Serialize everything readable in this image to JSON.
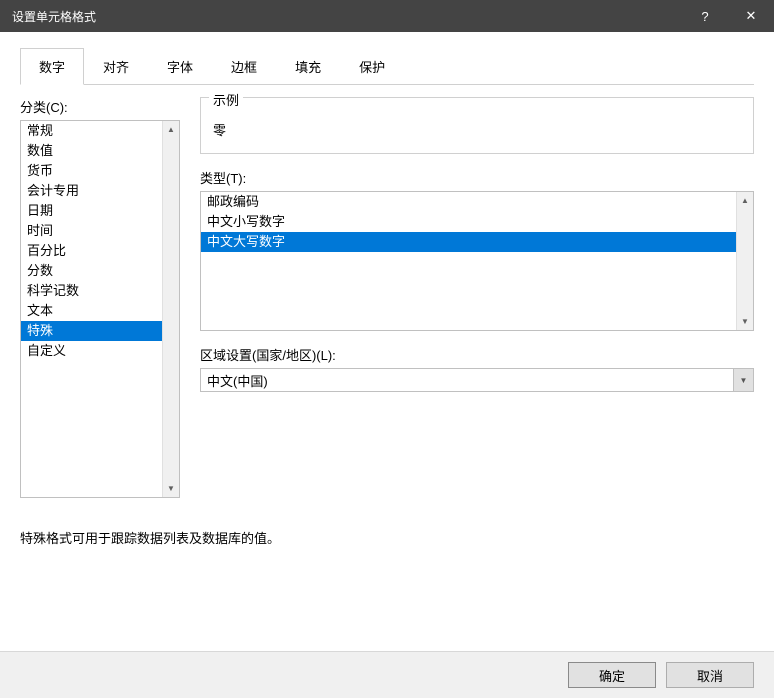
{
  "titlebar": {
    "title": "设置单元格格式",
    "help": "?",
    "close": "✕"
  },
  "tabs": [
    {
      "label": "数字",
      "active": true
    },
    {
      "label": "对齐",
      "active": false
    },
    {
      "label": "字体",
      "active": false
    },
    {
      "label": "边框",
      "active": false
    },
    {
      "label": "填充",
      "active": false
    },
    {
      "label": "保护",
      "active": false
    }
  ],
  "category": {
    "label": "分类(C):",
    "items": [
      "常规",
      "数值",
      "货币",
      "会计专用",
      "日期",
      "时间",
      "百分比",
      "分数",
      "科学记数",
      "文本",
      "特殊",
      "自定义"
    ],
    "selected": "特殊"
  },
  "sample": {
    "label": "示例",
    "value": "零"
  },
  "type": {
    "label": "类型(T):",
    "items": [
      "邮政编码",
      "中文小写数字",
      "中文大写数字"
    ],
    "selected": "中文大写数字"
  },
  "locale": {
    "label": "区域设置(国家/地区)(L):",
    "value": "中文(中国)"
  },
  "hint": "特殊格式可用于跟踪数据列表及数据库的值。",
  "buttons": {
    "ok": "确定",
    "cancel": "取消"
  }
}
